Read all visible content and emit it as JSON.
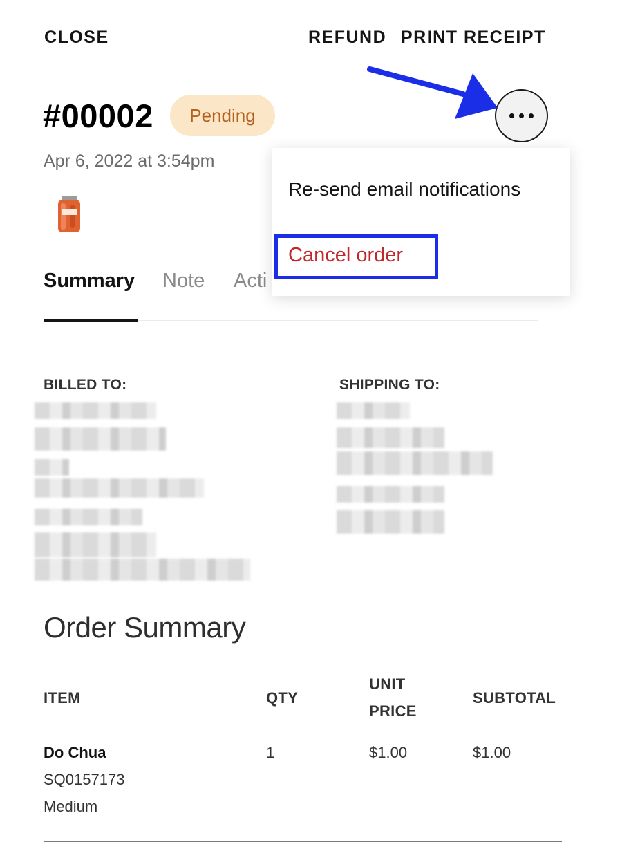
{
  "topbar": {
    "close_label": "CLOSE",
    "refund_label": "REFUND",
    "print_label": "PRINT RECEIPT"
  },
  "order": {
    "number": "#00002",
    "status": "Pending",
    "date": "Apr 6, 2022 at 3:54pm"
  },
  "tabs": [
    {
      "label": "Summary",
      "active": true
    },
    {
      "label": "Note",
      "active": false
    },
    {
      "label": "Acti",
      "active": false
    }
  ],
  "menu": {
    "resend_label": "Re-send email notifications",
    "cancel_label": "Cancel order"
  },
  "addresses": {
    "billed_heading": "BILLED TO:",
    "shipping_heading": "SHIPPING TO:"
  },
  "order_summary": {
    "title": "Order Summary",
    "columns": {
      "item": "ITEM",
      "qty": "QTY",
      "unit_price_line1": "UNIT",
      "unit_price_line2": "PRICE",
      "subtotal": "SUBTOTAL"
    },
    "items": [
      {
        "name": "Do Chua",
        "sku": "SQ0157173",
        "variant": "Medium",
        "qty": "1",
        "unit_price": "$1.00",
        "subtotal": "$1.00"
      }
    ]
  },
  "colors": {
    "badge_bg": "#fbe7c8",
    "badge_text": "#b5621e",
    "cancel_text": "#c0282e",
    "annotation_blue": "#1a2ee8"
  },
  "icons": {
    "more": "more-horizontal-icon",
    "arrow": "annotation-arrow-icon",
    "product": "product-jar-icon"
  }
}
